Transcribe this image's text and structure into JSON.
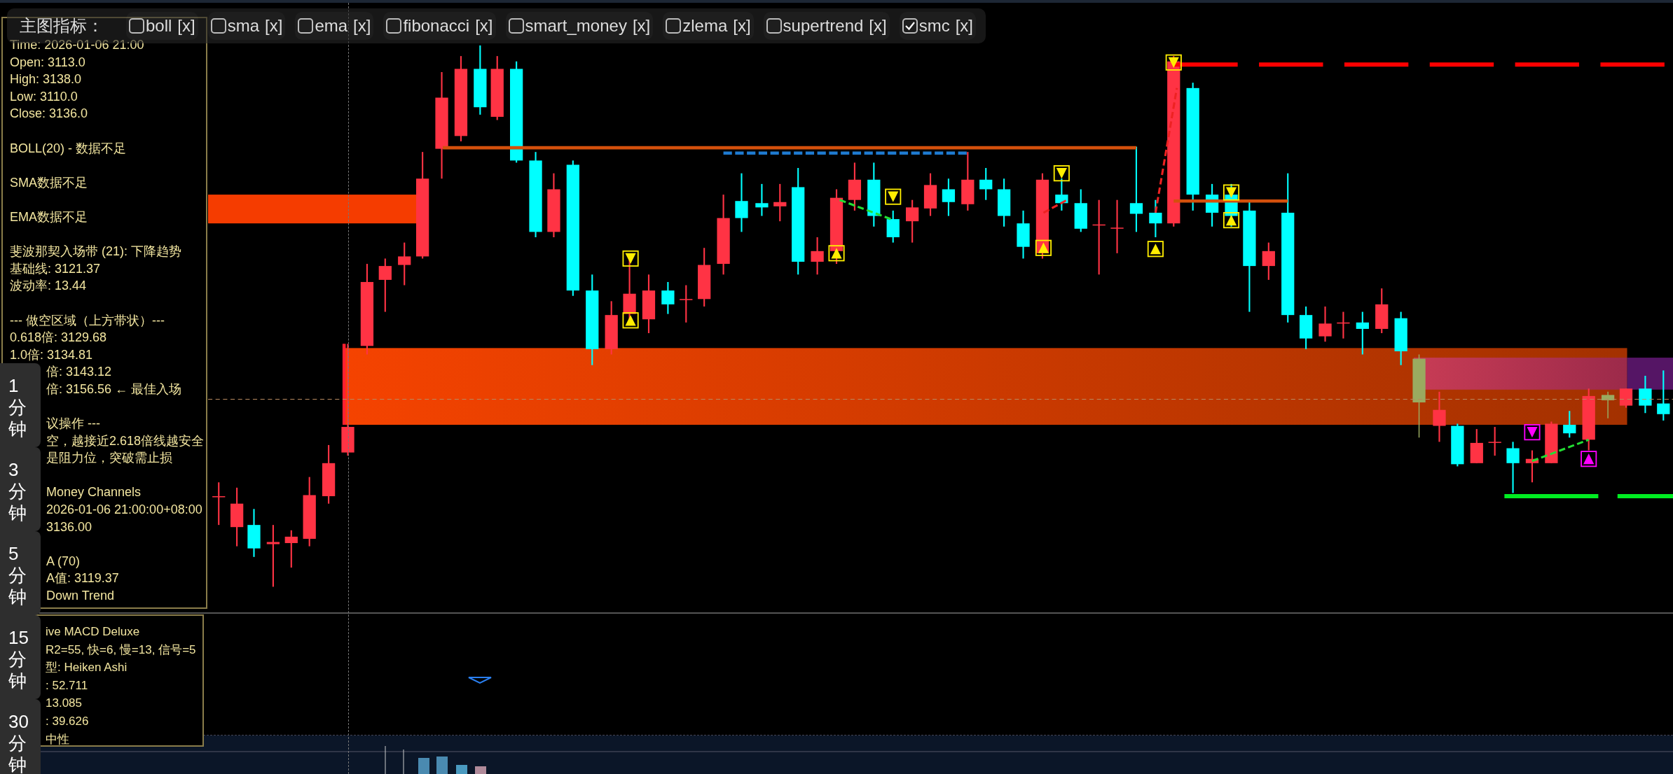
{
  "toolbar": {
    "label": "主图指标：",
    "indicators": [
      {
        "name": "boll",
        "close": "[x]",
        "checked": false
      },
      {
        "name": "sma",
        "close": "[x]",
        "checked": false
      },
      {
        "name": "ema",
        "close": "[x]",
        "checked": false
      },
      {
        "name": "fibonacci",
        "close": "[x]",
        "checked": false
      },
      {
        "name": "smart_money",
        "close": "[x]",
        "checked": false
      },
      {
        "name": "zlema",
        "close": "[x]",
        "checked": false
      },
      {
        "name": "supertrend",
        "close": "[x]",
        "checked": false
      },
      {
        "name": "smc",
        "close": "[x]",
        "checked": true
      }
    ]
  },
  "info_panel": {
    "sections": [
      [
        "Time: 2026-01-06 21:00",
        "Open: 3113.0",
        "High: 3138.0",
        "Low: 3110.0",
        "Close: 3136.0"
      ],
      [
        "BOLL(20) - 数据不足"
      ],
      [
        "SMA数据不足"
      ],
      [
        "EMA数据不足"
      ],
      [
        "斐波那契入场带 (21): 下降趋势",
        "基础线: 3121.37",
        "波动率: 13.44"
      ],
      [
        "--- 做空区域（上方带状）---",
        "0.618倍: 3129.68",
        "1.0倍: 3134.81",
        "倍: 3143.12",
        "倍: 3156.56 ← 最佳入场"
      ],
      [
        "议操作 ---",
        "空，越接近2.618倍线越安全",
        "是阻力位，突破需止损"
      ],
      [
        "Money Channels",
        "2026-01-06 21:00:00+08:00",
        "3136.00"
      ],
      [
        "A (70)",
        "A值: 3119.37",
        "Down Trend"
      ]
    ]
  },
  "timeframes": [
    {
      "label": "1分钟",
      "selected": false
    },
    {
      "label": "3分钟",
      "selected": false
    },
    {
      "label": "5分钟",
      "selected": false
    },
    {
      "label": "15分钟",
      "selected": false
    },
    {
      "label": "30分钟",
      "selected": false
    }
  ],
  "macd_panel": {
    "lines": [
      "ive MACD Deluxe",
      "R2=55, 快=6, 慢=13, 信号=5",
      "型: Heiken Ashi",
      ": 52.711",
      "13.085",
      ": 39.626",
      "中性"
    ]
  }
}
